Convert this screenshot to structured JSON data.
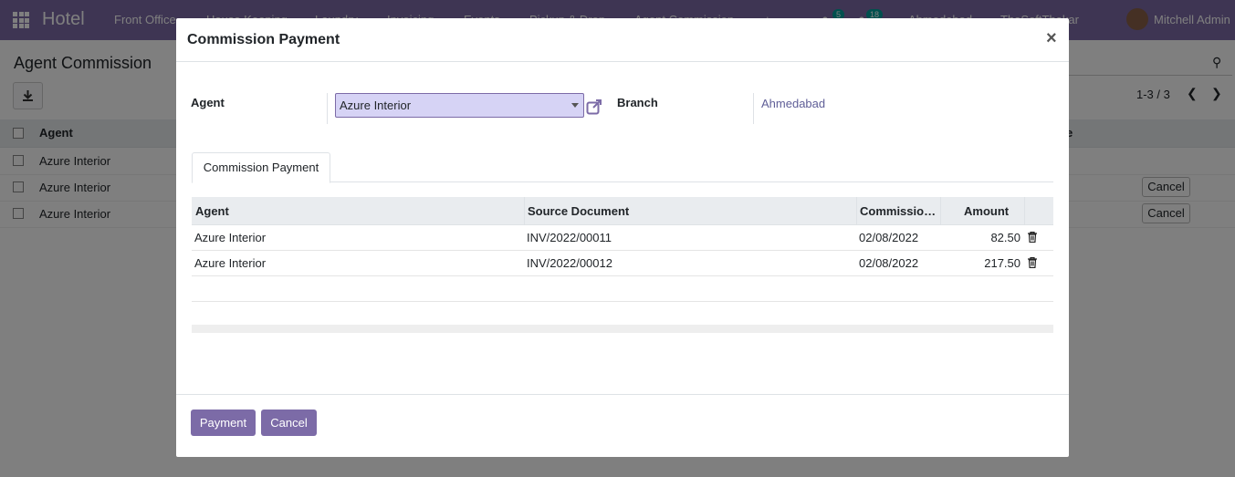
{
  "navbar": {
    "brand": "Hotel",
    "menu": [
      "Front Office",
      "House Keeping",
      "Laundry",
      "Invoicing",
      "Events",
      "Pickup & Drop",
      "Agent Commission",
      "+"
    ],
    "badge_messages": "5",
    "badge_activities": "18",
    "company": "Ahmedabad",
    "company2": "TheSoftThakar",
    "user": "Mitchell Admin"
  },
  "background": {
    "title": "Agent Commission",
    "pager": "1-3 / 3",
    "col_agent": "Agent",
    "col_state": "e",
    "rows": [
      {
        "agent": "Azure Interior",
        "cancel": ""
      },
      {
        "agent": "Azure Interior",
        "cancel": "Cancel"
      },
      {
        "agent": "Azure Interior",
        "cancel": "Cancel"
      }
    ]
  },
  "modal": {
    "title": "Commission Payment",
    "agent_label": "Agent",
    "agent_value": "Azure Interior",
    "branch_label": "Branch",
    "branch_value": "Ahmedabad",
    "tab_label": "Commission Payment",
    "columns": [
      "Agent",
      "Source Document",
      "Commissio…",
      "Amount"
    ],
    "lines": [
      {
        "agent": "Azure Interior",
        "source": "INV/2022/00011",
        "date": "02/08/2022",
        "amount": "82.50"
      },
      {
        "agent": "Azure Interior",
        "source": "INV/2022/00012",
        "date": "02/08/2022",
        "amount": "217.50"
      }
    ],
    "payment_button": "Payment",
    "cancel_button": "Cancel"
  },
  "colors": {
    "brand": "#7c6ba7",
    "selected_field": "#d6d3f5",
    "badge": "#00a09d"
  }
}
